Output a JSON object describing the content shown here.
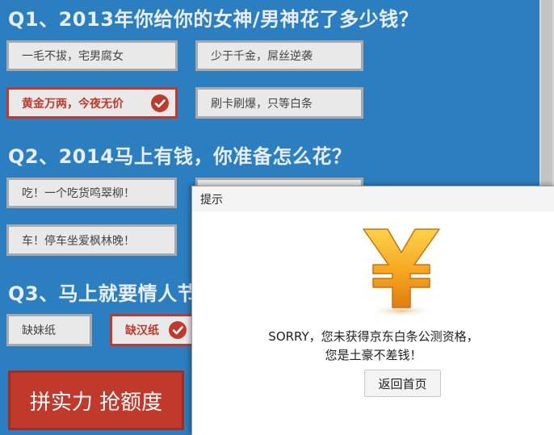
{
  "survey": {
    "q1": {
      "title": "Q1、2013年你给你的女神/男神花了多少钱？",
      "options": [
        "一毛不拔，宅男腐女",
        "少于千金，屌丝逆袭",
        "黄金万两，今夜无价",
        "刷卡刷爆，只等白条"
      ],
      "selected_index": 2
    },
    "q2": {
      "title": "Q2、2014马上有钱，你准备怎么花？",
      "options": [
        "吃！一个吃货鸣翠柳！",
        "车！停车坐爱枫林晚！"
      ]
    },
    "q3": {
      "title": "Q3、马上就要情人节",
      "options": [
        "缺妹纸",
        "缺汉纸"
      ],
      "selected_index": 1
    },
    "submit_label": "拼实力 抢额度"
  },
  "dialog": {
    "title": "提示",
    "icon": "yen-icon",
    "message_line1": "SORRY，您未获得京东白条公测资格，",
    "message_line2": "您是土豪不差钱！",
    "button_label": "返回首页"
  },
  "colors": {
    "background": "#2b7fc0",
    "accent": "#c0392b",
    "option_bg": "#e9e9e9",
    "icon_gold": "#f0a020"
  }
}
